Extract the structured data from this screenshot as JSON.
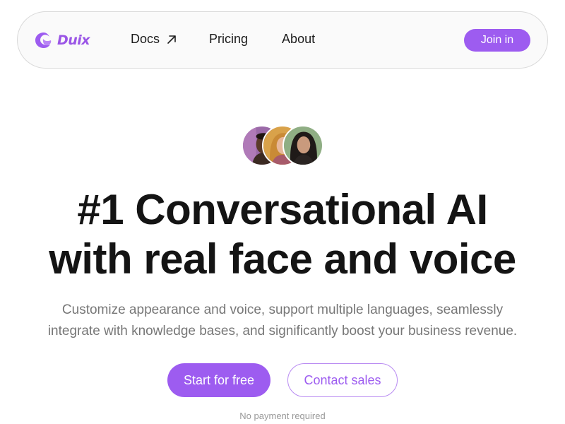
{
  "brand": {
    "name": "Duix",
    "color": "#9d5cf0"
  },
  "nav": {
    "links": [
      {
        "label": "Docs",
        "icon": "external-arrow-icon"
      },
      {
        "label": "Pricing"
      },
      {
        "label": "About"
      }
    ],
    "join_label": "Join in"
  },
  "hero": {
    "title_line1": "#1 Conversational AI",
    "title_line2": "with real face and voice",
    "subtitle_line1": "Customize appearance and voice, support multiple languages, seamlessly",
    "subtitle_line2": "integrate with knowledge bases, and significantly boost your business revenue.",
    "primary_cta": "Start for free",
    "secondary_cta": "Contact sales",
    "note": "No payment required"
  },
  "avatars": [
    {
      "name": "avatar-man-icon",
      "bg": "#9b6aa8"
    },
    {
      "name": "avatar-woman-blonde-icon",
      "bg": "#d9a24a"
    },
    {
      "name": "avatar-woman-dark-hair-icon",
      "bg": "#8fae84"
    }
  ]
}
